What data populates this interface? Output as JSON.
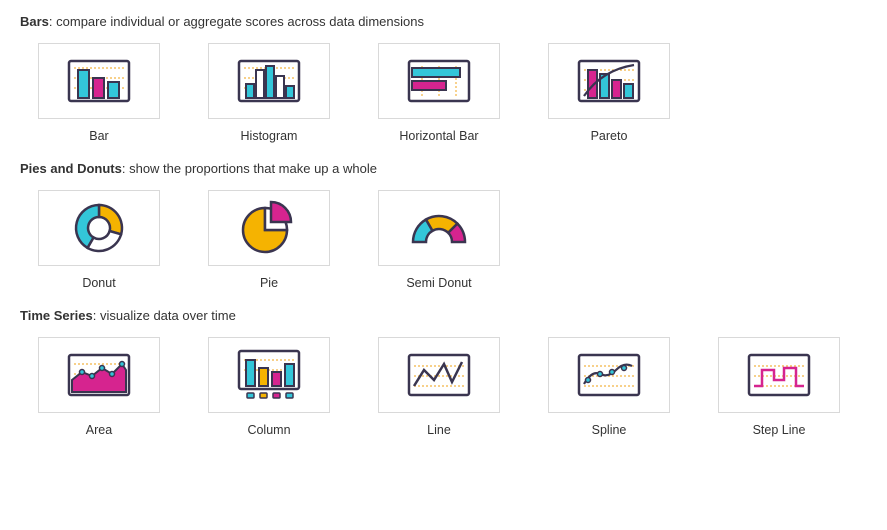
{
  "sections": [
    {
      "title": "Bars",
      "desc": ": compare individual or aggregate scores across data dimensions",
      "items": [
        {
          "label": "Bar",
          "icon": "bar"
        },
        {
          "label": "Histogram",
          "icon": "histogram"
        },
        {
          "label": "Horizontal Bar",
          "icon": "hbar"
        },
        {
          "label": "Pareto",
          "icon": "pareto"
        }
      ]
    },
    {
      "title": "Pies and Donuts",
      "desc": ": show the proportions that make up a whole",
      "items": [
        {
          "label": "Donut",
          "icon": "donut"
        },
        {
          "label": "Pie",
          "icon": "pie"
        },
        {
          "label": "Semi Donut",
          "icon": "semidonut"
        }
      ]
    },
    {
      "title": "Time Series",
      "desc": ": visualize data over time",
      "items": [
        {
          "label": "Area",
          "icon": "area"
        },
        {
          "label": "Column",
          "icon": "column"
        },
        {
          "label": "Line",
          "icon": "line"
        },
        {
          "label": "Spline",
          "icon": "spline"
        },
        {
          "label": "Step Line",
          "icon": "stepline"
        }
      ]
    }
  ],
  "colors": {
    "frame": "#3a3550",
    "cyan": "#33c6d9",
    "magenta": "#d6248f",
    "yellow": "#f5b301",
    "dots": "#f2b544"
  }
}
